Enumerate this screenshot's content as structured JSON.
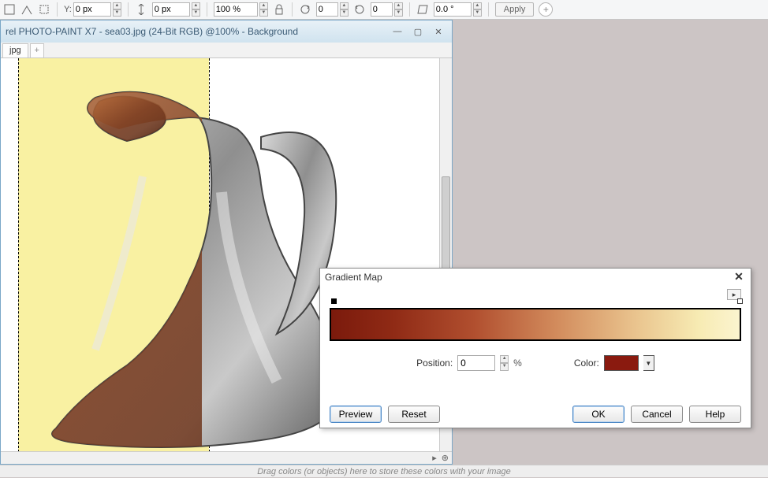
{
  "toolbar": {
    "y_label": "Y:",
    "y_value": "0 px",
    "h_value": "0 px",
    "scale_value": "100 %",
    "rot1_value": "0",
    "rot2_value": "0",
    "angle_value": "0.0 °",
    "apply_label": "Apply"
  },
  "doc_window": {
    "title": "rel PHOTO-PAINT X7 - sea03.jpg (24-Bit RGB) @100% - Background",
    "tab_label": "jpg",
    "tab_plus": "+"
  },
  "status": {
    "magnify_icon": "⊕",
    "arrow_icon": "▸"
  },
  "bottom_hint": "Drag colors (or objects) here to store these colors with your image",
  "dialog": {
    "title": "Gradient Map",
    "flyout": "▸",
    "position_label": "Position:",
    "position_value": "0",
    "percent": "%",
    "color_label": "Color:",
    "color_hex": "#8a1a0f",
    "buttons": {
      "preview": "Preview",
      "reset": "Reset",
      "ok": "OK",
      "cancel": "Cancel",
      "help": "Help"
    }
  },
  "chart_data": {
    "type": "gradient",
    "stops": [
      {
        "position": 0,
        "color": "#7b1a0c"
      },
      {
        "position": 100,
        "color": "#fbf4cf"
      }
    ],
    "selected_stop_position": 0,
    "selected_stop_color": "#8a1a0f"
  }
}
